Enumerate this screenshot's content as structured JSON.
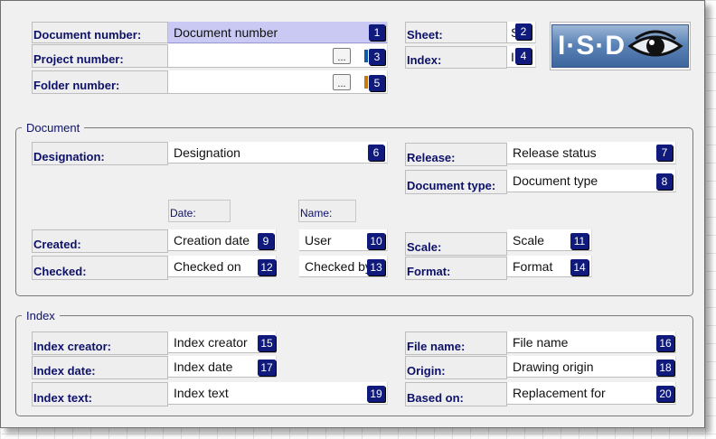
{
  "header": {
    "document_number": {
      "label": "Document number:",
      "value": "Document number",
      "badge": "1"
    },
    "project_number": {
      "label": "Project number:",
      "value": "",
      "button": "...",
      "badge": "3"
    },
    "folder_number": {
      "label": "Folder number:",
      "value": "",
      "button": "...",
      "badge": "5"
    },
    "sheet": {
      "label": "Sheet:",
      "value": "S",
      "badge": "2"
    },
    "index": {
      "label": "Index:",
      "value": "I",
      "badge": "4"
    },
    "logo_text": "I·S·D"
  },
  "document_group": {
    "title": "Document",
    "designation": {
      "label": "Designation:",
      "value": "Designation",
      "badge": "6"
    },
    "release": {
      "label": "Release:",
      "value": "Release status",
      "badge": "7"
    },
    "document_type": {
      "label": "Document type:",
      "value": "Document type",
      "badge": "8"
    },
    "date_header": "Date:",
    "name_header": "Name:",
    "created": {
      "label": "Created:",
      "date": "Creation date",
      "date_badge": "9",
      "name": "User",
      "name_badge": "10"
    },
    "checked": {
      "label": "Checked:",
      "date": "Checked on",
      "date_badge": "12",
      "name": "Checked by",
      "name_badge": "13"
    },
    "scale": {
      "label": "Scale:",
      "value": "Scale",
      "badge": "11"
    },
    "format": {
      "label": "Format:",
      "value": "Format",
      "badge": "14"
    }
  },
  "index_group": {
    "title": "Index",
    "index_creator": {
      "label": "Index creator:",
      "value": "Index creator",
      "badge": "15"
    },
    "index_date": {
      "label": "Index date:",
      "value": "Index date",
      "badge": "17"
    },
    "index_text": {
      "label": "Index text:",
      "value": "Index text",
      "badge": "19"
    },
    "file_name": {
      "label": "File name:",
      "value": "File name",
      "badge": "16"
    },
    "origin": {
      "label": "Origin:",
      "value": "Drawing origin",
      "badge": "18"
    },
    "based_on": {
      "label": "Based on:",
      "value": "Replacement for",
      "badge": "20"
    }
  },
  "colors": {
    "badge": "#0f1a7c",
    "label_text": "#0d1168",
    "highlight": "#c9c9f3"
  }
}
